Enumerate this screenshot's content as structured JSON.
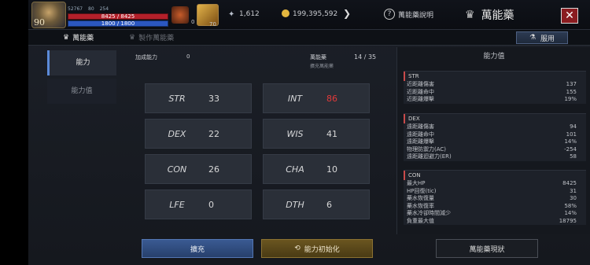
{
  "topbar": {
    "level": "90",
    "stat_a": "52767",
    "stat_b": "80",
    "stat_c": "254",
    "hp": "8425 / 8425",
    "mp": "1800 / 1800",
    "potion_count": "0",
    "item_count": "70",
    "feather_value": "1,612",
    "gold_value": "199,395,592",
    "help_label": "萬能藥說明",
    "window_title": "萬能藥",
    "close_label": "✕"
  },
  "subbar": {
    "tab_active": "萬能藥",
    "tab_inactive": "製作萬能藥",
    "use_button": "服用"
  },
  "left_tabs": [
    "能力",
    "能力值"
  ],
  "center": {
    "added_label": "加成能力",
    "added_value": "0",
    "elixir_label": "萬能藥",
    "elixir_count": "14 / 35",
    "elixir_sub": "擴充萬能藥"
  },
  "stats": [
    {
      "name": "STR",
      "value": "33",
      "highlight": false
    },
    {
      "name": "INT",
      "value": "86",
      "highlight": true
    },
    {
      "name": "DEX",
      "value": "22",
      "highlight": false
    },
    {
      "name": "WIS",
      "value": "41",
      "highlight": false
    },
    {
      "name": "CON",
      "value": "26",
      "highlight": false
    },
    {
      "name": "CHA",
      "value": "10",
      "highlight": false
    },
    {
      "name": "LFE",
      "value": "0",
      "highlight": false
    },
    {
      "name": "DTH",
      "value": "6",
      "highlight": false
    }
  ],
  "right_panel": {
    "title": "能力值",
    "groups": [
      {
        "title": "STR",
        "rows": [
          {
            "label": "近距離傷害",
            "value": "137"
          },
          {
            "label": "近距離命中",
            "value": "155"
          },
          {
            "label": "近距離爆擊",
            "value": "19%"
          }
        ]
      },
      {
        "title": "DEX",
        "rows": [
          {
            "label": "遠距離傷害",
            "value": "94"
          },
          {
            "label": "遠距離命中",
            "value": "101"
          },
          {
            "label": "遠距離爆擊",
            "value": "14%"
          },
          {
            "label": "物理防禦力(AC)",
            "value": "-254"
          },
          {
            "label": "遠距離迴避力(ER)",
            "value": "58"
          }
        ]
      },
      {
        "title": "CON",
        "rows": [
          {
            "label": "最大HP",
            "value": "8425"
          },
          {
            "label": "HP回復(tic)",
            "value": "31"
          },
          {
            "label": "藥水恢復量",
            "value": "30"
          },
          {
            "label": "藥水恢復率",
            "value": "58%"
          },
          {
            "label": "藥水冷卻時間減少",
            "value": "14%"
          },
          {
            "label": "負重最大值",
            "value": "18795"
          }
        ]
      }
    ]
  },
  "buttons": {
    "expand": "擴充",
    "reset": "能力初始化",
    "status": "萬能藥現狀"
  }
}
